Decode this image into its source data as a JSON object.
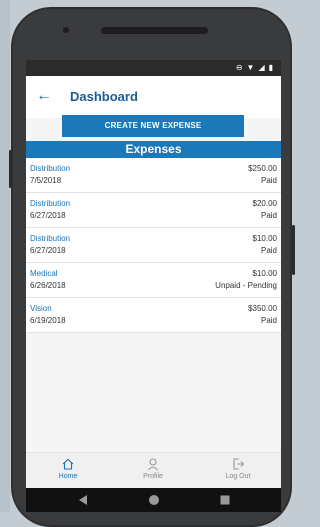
{
  "header": {
    "title": "Dashboard"
  },
  "actions": {
    "create_label": "CREATE NEW EXPENSE"
  },
  "section": {
    "title": "Expenses"
  },
  "expenses": [
    {
      "category": "Distribution",
      "date": "7/5/2018",
      "amount": "$250.00",
      "status": "Paid"
    },
    {
      "category": "Distribution",
      "date": "6/27/2018",
      "amount": "$20.00",
      "status": "Paid"
    },
    {
      "category": "Distribution",
      "date": "6/27/2018",
      "amount": "$10.00",
      "status": "Paid"
    },
    {
      "category": "Medical",
      "date": "6/26/2018",
      "amount": "$10.00",
      "status": "Unpaid - Pending"
    },
    {
      "category": "Vision",
      "date": "6/19/2018",
      "amount": "$350.00",
      "status": "Paid"
    }
  ],
  "nav": [
    {
      "label": "Home",
      "icon": "home-icon",
      "active": true
    },
    {
      "label": "Profile",
      "icon": "profile-icon",
      "active": false
    },
    {
      "label": "Log Out",
      "icon": "logout-icon",
      "active": false
    }
  ],
  "colors": {
    "accent": "#1b78b9",
    "link": "#1a73b8",
    "status_bar": "#2b2b2b"
  }
}
